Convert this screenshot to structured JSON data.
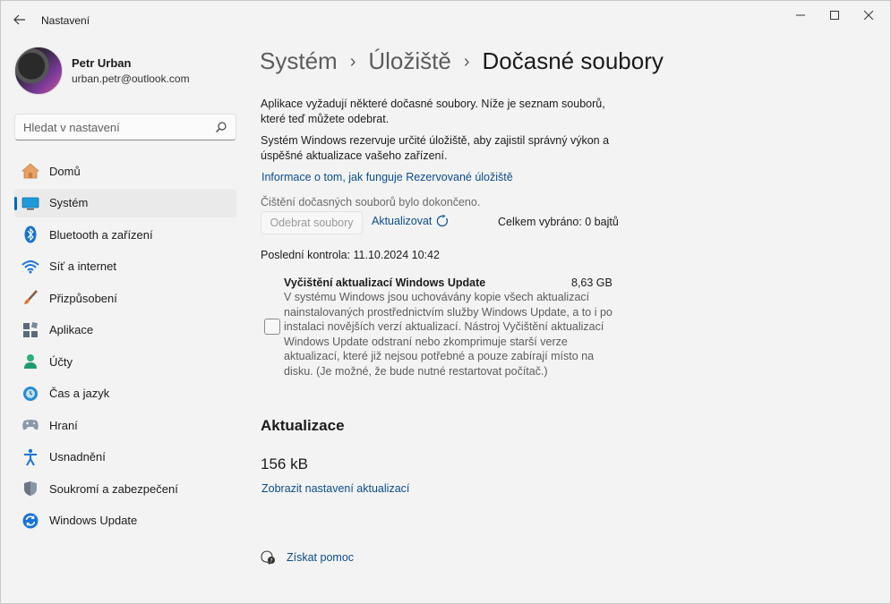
{
  "window": {
    "title": "Nastavení",
    "back_icon": "arrow-left-icon",
    "controls": [
      "minimize-icon",
      "maximize-icon",
      "close-icon"
    ]
  },
  "profile": {
    "name": "Petr Urban",
    "email": "urban.petr@outlook.com"
  },
  "search": {
    "placeholder": "Hledat v nastavení",
    "icon": "search-icon"
  },
  "sidebar": {
    "items": [
      {
        "label": "Domů",
        "icon": "home-icon",
        "active": false
      },
      {
        "label": "Systém",
        "icon": "system-icon",
        "active": true
      },
      {
        "label": "Bluetooth a zařízení",
        "icon": "bluetooth-icon",
        "active": false
      },
      {
        "label": "Síť a internet",
        "icon": "wifi-icon",
        "active": false
      },
      {
        "label": "Přizpůsobení",
        "icon": "brush-icon",
        "active": false
      },
      {
        "label": "Aplikace",
        "icon": "apps-icon",
        "active": false
      },
      {
        "label": "Účty",
        "icon": "account-icon",
        "active": false
      },
      {
        "label": "Čas a jazyk",
        "icon": "time-language-icon",
        "active": false
      },
      {
        "label": "Hraní",
        "icon": "gamepad-icon",
        "active": false
      },
      {
        "label": "Usnadnění",
        "icon": "accessibility-icon",
        "active": false
      },
      {
        "label": "Soukromí a zabezpečení",
        "icon": "shield-icon",
        "active": false
      },
      {
        "label": "Windows Update",
        "icon": "update-icon",
        "active": false
      }
    ]
  },
  "breadcrumb": {
    "items": [
      "Systém",
      "Úložiště"
    ],
    "current": "Dočasné soubory",
    "separator": "›"
  },
  "main": {
    "intro1": "Aplikace vyžadují některé dočasné soubory. Níže je seznam souborů, které teď můžete odebrat.",
    "intro2": "Systém Windows rezervuje určité úložiště, aby zajistil správný výkon a úspěšné aktualizace vašeho zařízení.",
    "reserved_link": "Informace o tom, jak funguje Rezervované úložiště",
    "cleanup_status": "Čištění dočasných souborů bylo dokončeno.",
    "remove_button": "Odebrat soubory",
    "refresh_label": "Aktualizovat",
    "total_selected": "Celkem vybráno: 0 bajtů",
    "last_check": "Poslední kontrola: 11.10.2024 10:42",
    "item": {
      "title": "Vyčištění aktualizací Windows Update",
      "size": "8,63 GB",
      "description": "V systému Windows jsou uchovávány kopie všech aktualizací nainstalovaných prostřednictvím služby Windows Update, a to i po instalaci novějších verzí aktualizací. Nástroj Vyčištění aktualizací Windows Update odstraní nebo zkomprimuje starší verze aktualizací, které již nejsou potřebné a pouze zabírají místo na disku. (Je možné, že bude nutné restartovat počítač.)",
      "checked": false
    },
    "section_title": "Aktualizace",
    "section_size": "156 kB",
    "section_link": "Zobrazit nastavení aktualizací",
    "help_label": "Získat pomoc"
  },
  "colors": {
    "accent": "#0067c0",
    "link": "#0a4d8c",
    "background": "#f3f3f3"
  }
}
